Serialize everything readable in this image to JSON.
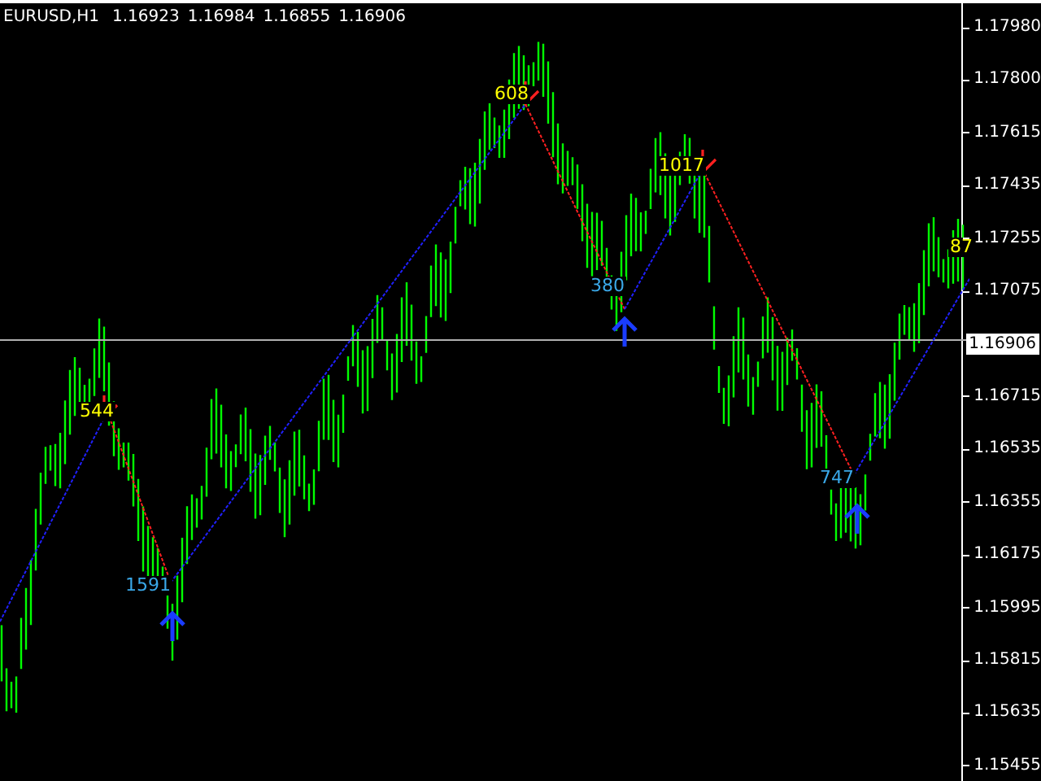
{
  "chart": {
    "symbol": "EURUSD,H1",
    "ohlc": [
      "1.16923",
      "1.16984",
      "1.16855",
      "1.16906"
    ],
    "price_ticks": [
      "1.17980",
      "1.17800",
      "1.17615",
      "1.17435",
      "1.17255",
      "1.17075",
      "1.16715",
      "1.16535",
      "1.16355",
      "1.16175",
      "1.15995",
      "1.15815",
      "1.15635",
      "1.15455"
    ],
    "current_price": "1.16906",
    "signals": [
      {
        "kind": "sell",
        "label": "544"
      },
      {
        "kind": "buy",
        "label": "1591"
      },
      {
        "kind": "sell",
        "label": "608"
      },
      {
        "kind": "buy",
        "label": "380"
      },
      {
        "kind": "sell",
        "label": "1017"
      },
      {
        "kind": "buy",
        "label": "747"
      },
      {
        "kind": "sell",
        "label": "87"
      }
    ]
  }
}
